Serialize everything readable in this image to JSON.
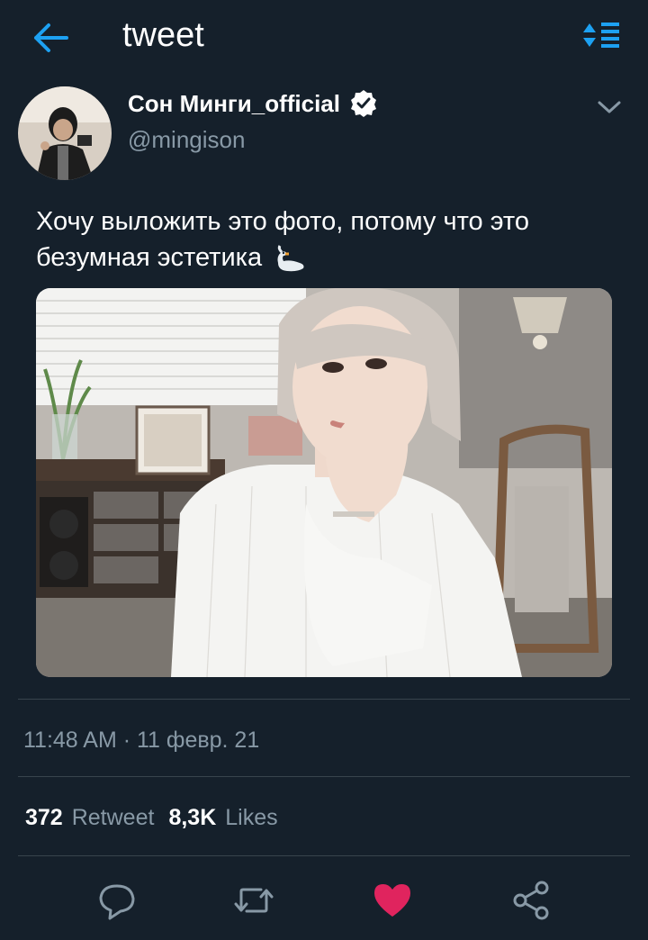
{
  "header": {
    "title": "tweet",
    "back_icon": "arrow-left-icon",
    "sort_icon": "sort-icon",
    "accent": "#1da1f2"
  },
  "author": {
    "display_name": "Сон Минги_official",
    "handle": "@mingison",
    "verified": true
  },
  "tweet": {
    "text": "Хочу выложить это фото, потому что это безумная эстетика",
    "emoji": "swan-emoji"
  },
  "meta": {
    "timestamp": "11:48 AM · 11 февр. 21"
  },
  "stats": {
    "retweets_count": "372",
    "retweets_label": "Retweet",
    "likes_count": "8,3K",
    "likes_label": "Likes"
  },
  "actions": {
    "reply_icon": "reply-icon",
    "retweet_icon": "retweet-icon",
    "like_icon": "heart-icon",
    "share_icon": "share-icon",
    "like_color": "#e0245e"
  },
  "colors": {
    "background": "#15202b",
    "secondary_text": "#8899a6",
    "divider": "#38444d"
  }
}
